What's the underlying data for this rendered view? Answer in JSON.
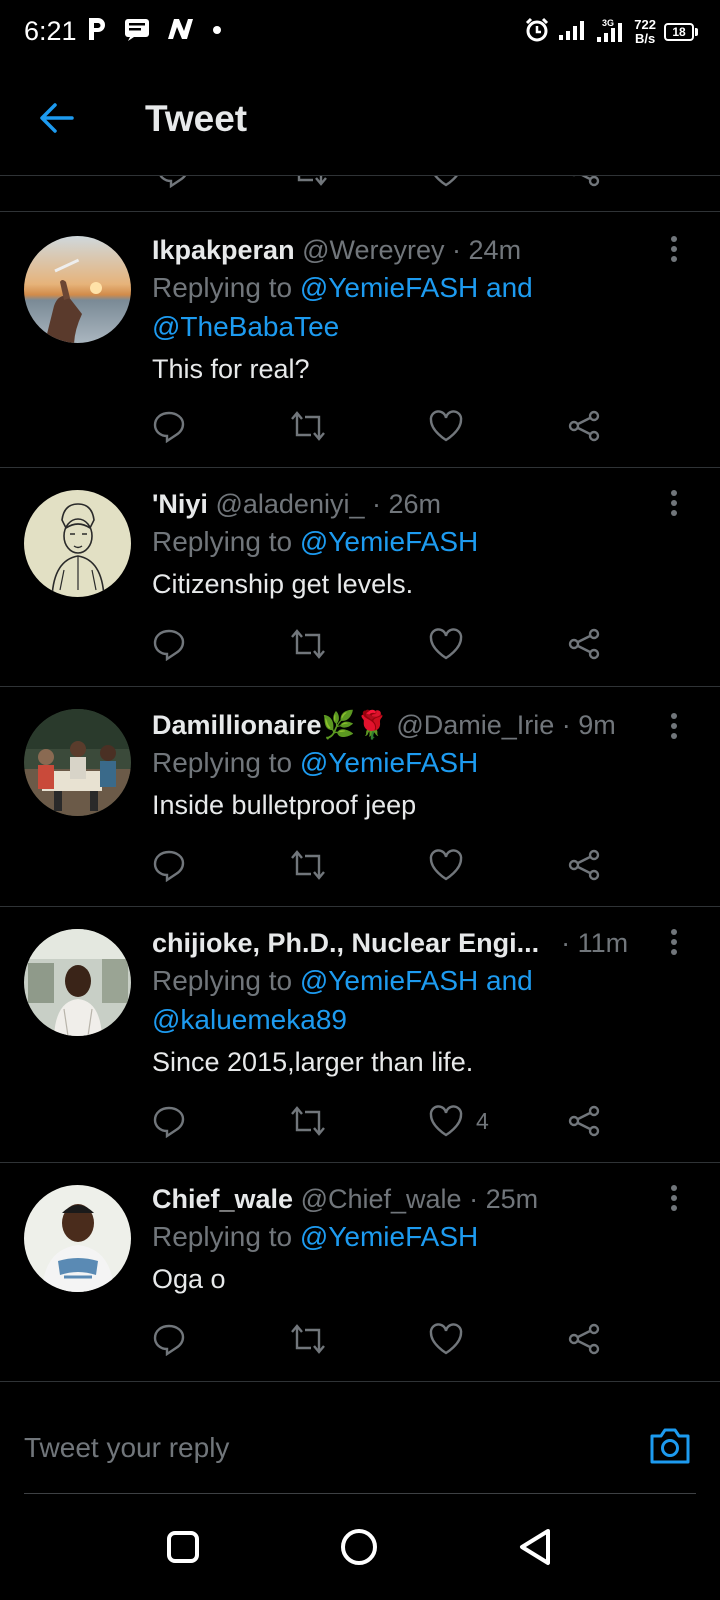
{
  "status_bar": {
    "time": "6:21",
    "left_icons": [
      "parking-icon",
      "message-icon",
      "news-icon",
      "dot-icon"
    ],
    "right_icons": [
      "alarm-icon",
      "signal-icon",
      "signal-3g-icon"
    ],
    "speed_value": "722",
    "speed_unit": "B/s",
    "battery": "18"
  },
  "header": {
    "title": "Tweet"
  },
  "tweets": [
    {
      "name": "Ikpakperan",
      "handle": "@Wereyrey",
      "time": "· 24m",
      "reply_prefix": "Replying to ",
      "mention1": "@YemieFASH and",
      "mention2": "@TheBabaTee",
      "text": "This for real?",
      "likes": ""
    },
    {
      "name": "'Niyi",
      "handle": "@aladeniyi_",
      "time": "· 26m",
      "reply_prefix": "Replying to ",
      "mention1": "@YemieFASH",
      "text": "Citizenship get levels.",
      "likes": ""
    },
    {
      "name": "Damillionaire",
      "emoji": "🌿🌹",
      "handle": "@Damie_Irie",
      "time": "· 9m",
      "reply_prefix": "Replying to ",
      "mention1": "@YemieFASH",
      "text": "Inside bulletproof jeep",
      "likes": ""
    },
    {
      "name": "chijioke, Ph.D., Nuclear Engi...",
      "handle": "",
      "time": "· 11m",
      "reply_prefix": "Replying to ",
      "mention1": "@YemieFASH and",
      "mention2": "@kaluemeka89",
      "text": "Since 2015,larger than life.",
      "likes": "4"
    },
    {
      "name": "Chief_wale",
      "handle": "@Chief_wale",
      "time": "· 25m",
      "reply_prefix": "Replying to ",
      "mention1": "@YemieFASH",
      "text": "Oga o",
      "likes": ""
    }
  ],
  "reply_box": {
    "placeholder": "Tweet your reply"
  },
  "colors": {
    "accent": "#1d9bf0",
    "muted": "#71767b",
    "divider": "#2f3336"
  }
}
